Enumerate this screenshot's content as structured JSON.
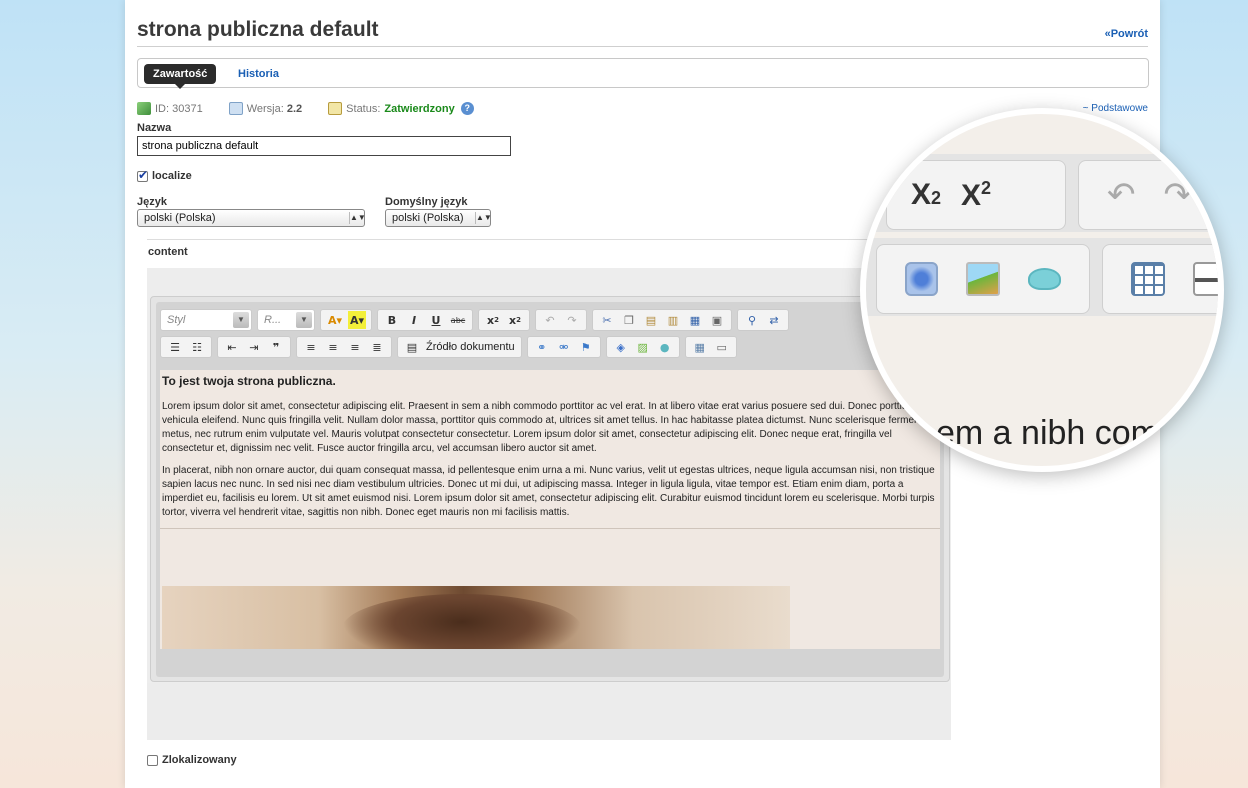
{
  "header": {
    "title": "strona publiczna default",
    "back_label": "«Powrót"
  },
  "tabs": {
    "active": "Zawartość",
    "history": "Historia"
  },
  "meta": {
    "id_label": "ID:",
    "id_value": "30371",
    "version_label": "Wersja:",
    "version_value": "2.2",
    "status_label": "Status:",
    "status_value": "Zatwierdzony",
    "basic_link": "~ Podstawowe"
  },
  "form": {
    "name_label": "Nazwa",
    "name_value": "strona publiczna default",
    "localize_label": "localize",
    "language_label": "Język",
    "language_value": "polski (Polska)",
    "default_language_label": "Domyślny język",
    "default_language_value": "polski (Polska)",
    "content_label": "content",
    "localized_label": "Zlokalizowany"
  },
  "toolbar": {
    "style_combo": "Styl",
    "format_combo": "R...",
    "source_button": "Źródło dokumentu",
    "sub": "x",
    "sup": "x"
  },
  "document": {
    "heading": "To jest twoja strona publiczna.",
    "paragraph1": "Lorem ipsum dolor sit amet, consectetur adipiscing elit. Praesent in sem a nibh commodo porttitor ac vel erat. In at libero vitae erat varius posuere sed dui. Donec porttitor vehicula eleifend. Nunc quis fringilla velit. Nullam dolor massa, porttitor quis commodo at, ultrices sit amet tellus. In hac habitasse platea dictumst. Nunc scelerisque fermentum metus, nec rutrum enim vulputate vel. Mauris volutpat consectetur consectetur. Lorem ipsum dolor sit amet, consectetur adipiscing elit. Donec neque erat, fringilla vel consectetur et, dignissim nec velit. Fusce auctor fringilla arcu, vel accumsan libero auctor sit amet.",
    "paragraph2": "In placerat, nibh non ornare auctor, dui quam consequat massa, id pellentesque enim urna a mi. Nunc varius, velit ut egestas ultrices, neque ligula accumsan nisi, non tristique sapien lacus nec nunc. In sed nisi nec diam vestibulum ultricies. Donec ut mi dui, ut adipiscing massa. Integer in ligula ligula, vitae tempor est. Etiam enim diam, porta a imperdiet eu, facilisis eu lorem. Ut sit amet euismod nisi. Lorem ipsum dolor sit amet, consectetur adipiscing elit. Curabitur euismod tincidunt lorem eu scelerisque. Morbi turpis tortor, viverra vel hendrerit vitae, sagittis non nibh. Donec eget mauris non mi facilisis mattis."
  },
  "zoom": {
    "sub_base": "X",
    "sub_index": "2",
    "sup_base": "X",
    "sup_index": "2",
    "text": "em a nibh com"
  },
  "icons": [
    "document-icon",
    "copy-icon",
    "status-icon",
    "help-icon",
    "text-color-icon",
    "bg-color-icon",
    "bold-icon",
    "italic-icon",
    "underline-icon",
    "strikethrough-icon",
    "subscript-icon",
    "superscript-icon",
    "undo-icon",
    "redo-icon",
    "cut-icon",
    "copy-icon",
    "paste-icon",
    "paste-text-icon",
    "paste-word-icon",
    "select-all-icon",
    "find-icon",
    "replace-icon",
    "numbered-list-icon",
    "bulleted-list-icon",
    "outdent-icon",
    "indent-icon",
    "blockquote-icon",
    "align-left-icon",
    "align-center-icon",
    "align-right-icon",
    "justify-icon",
    "link-icon",
    "unlink-icon",
    "anchor-icon",
    "flash-icon",
    "image-icon",
    "smiley-icon",
    "table-icon",
    "horizontal-rule-icon"
  ],
  "colors": {
    "link": "#1a5fb4",
    "status_ok": "#1b8a1b",
    "active_tab": "#2b2b2b",
    "editor_bg": "#f0e8e2"
  }
}
